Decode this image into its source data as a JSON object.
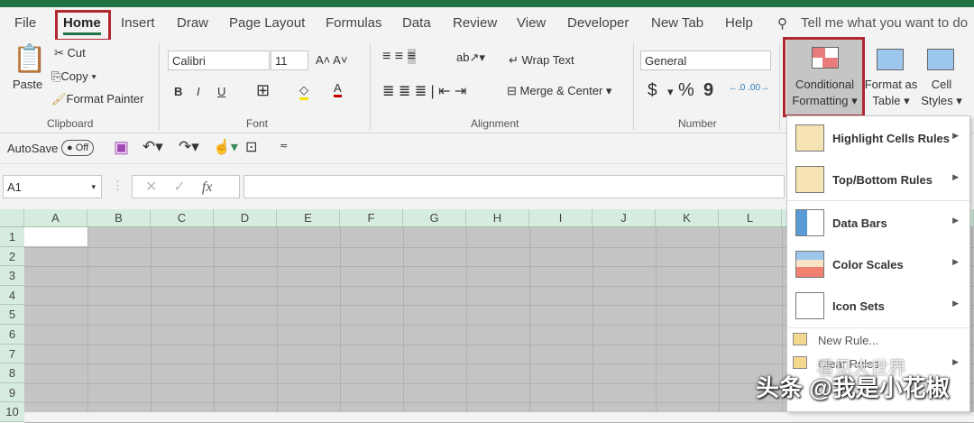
{
  "tabs": [
    "File",
    "Home",
    "Insert",
    "Draw",
    "Page Layout",
    "Formulas",
    "Data",
    "Review",
    "View",
    "Developer",
    "New Tab",
    "Help"
  ],
  "search_placeholder": "Tell me what you want to do",
  "clipboard": {
    "paste": "Paste",
    "cut": "Cut",
    "copy": "Copy",
    "format_painter": "Format Painter",
    "label": "Clipboard"
  },
  "font": {
    "name": "Calibri",
    "size": "11",
    "label": "Font",
    "bold": "B",
    "italic": "I",
    "underline": "U"
  },
  "alignment": {
    "wrap": "Wrap Text",
    "merge": "Merge & Center",
    "label": "Alignment"
  },
  "number": {
    "format": "General",
    "currency": "$",
    "percent": "%",
    "comma": "9",
    "label": "Number"
  },
  "styles": {
    "conditional1": "Conditional",
    "conditional2": "Formatting",
    "table1": "Format as",
    "table2": "Table",
    "cell1": "Cell",
    "cell2": "Styles"
  },
  "qat": {
    "autosave": "AutoSave",
    "toggle": "Off"
  },
  "formula": {
    "namebox": "A1",
    "fx": "fx",
    "value": ""
  },
  "columns": [
    "A",
    "B",
    "C",
    "D",
    "E",
    "F",
    "G",
    "H",
    "I",
    "J",
    "K",
    "L"
  ],
  "rows": [
    "1",
    "2",
    "3",
    "4",
    "5",
    "6",
    "7",
    "8",
    "9",
    "10"
  ],
  "menu": {
    "items": [
      "Highlight Cells Rules",
      "Top/Bottom Rules",
      "Data Bars",
      "Color Scales",
      "Icon Sets"
    ],
    "new_rule": "New Rule...",
    "clear_rules": "Clear Rules"
  },
  "watermark": {
    "main": "头条 @我是小花椒",
    "secondary": "看见大世界"
  },
  "colors": {
    "accent": "#217346",
    "highlight": "#b0272f"
  }
}
